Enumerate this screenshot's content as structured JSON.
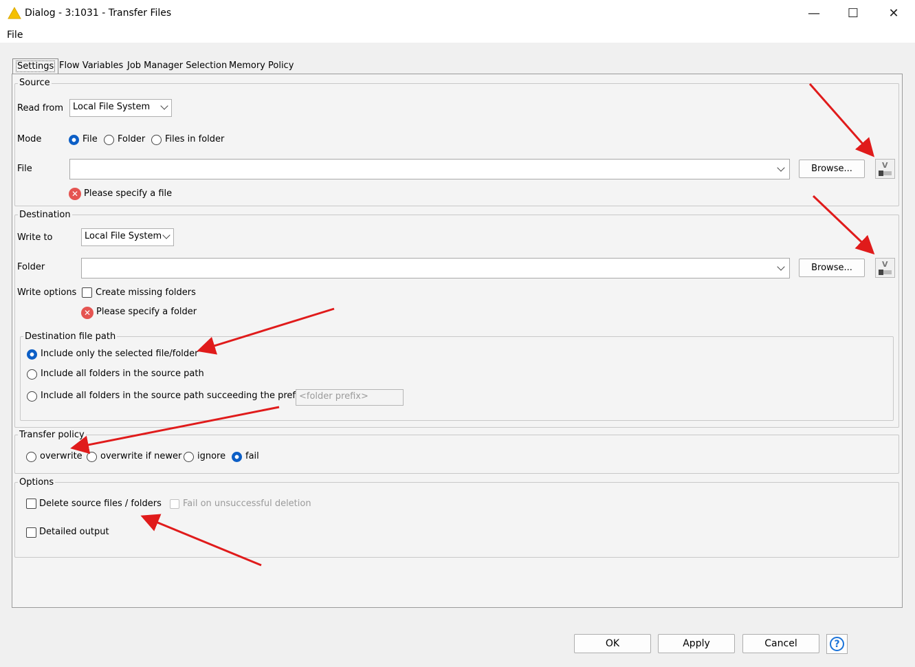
{
  "window": {
    "title": "Dialog - 3:1031 - Transfer Files",
    "minimize": "—",
    "maximize": "☐",
    "close": "✕"
  },
  "menu": {
    "file": "File"
  },
  "tabs": [
    {
      "label": "Settings",
      "active": true
    },
    {
      "label": "Flow Variables"
    },
    {
      "label": "Job Manager Selection"
    },
    {
      "label": "Memory Policy"
    }
  ],
  "source": {
    "legend": "Source",
    "read_from_label": "Read from",
    "read_from_value": "Local File System",
    "mode_label": "Mode",
    "mode_options": [
      "File",
      "Folder",
      "Files in folder"
    ],
    "mode_selected": "File",
    "file_label": "File",
    "file_value": "",
    "browse_label": "Browse...",
    "error": "Please specify a file"
  },
  "destination": {
    "legend": "Destination",
    "write_to_label": "Write to",
    "write_to_value": "Local File System",
    "folder_label": "Folder",
    "folder_value": "",
    "browse_label": "Browse...",
    "write_options_label": "Write options",
    "create_missing_label": "Create missing folders",
    "error": "Please specify a folder",
    "path_legend": "Destination file path",
    "path_options": [
      "Include only the selected file/folder",
      "Include all folders in the source path",
      "Include all folders in the source path succeeding the prefix"
    ],
    "path_selected": 0,
    "prefix_placeholder": "<folder prefix>"
  },
  "transfer_policy": {
    "legend": "Transfer policy",
    "options": [
      "overwrite",
      "overwrite if newer",
      "ignore",
      "fail"
    ],
    "selected": "fail"
  },
  "options": {
    "legend": "Options",
    "delete_source_label": "Delete source files / folders",
    "fail_deletion_label": "Fail on unsuccessful deletion",
    "detailed_output_label": "Detailed output"
  },
  "buttons": {
    "ok": "OK",
    "apply": "Apply",
    "cancel": "Cancel",
    "help": "?"
  },
  "colors": {
    "annotation_arrow": "#e01b1b",
    "radio_selected": "#0d5fc6",
    "error": "#e55451"
  }
}
